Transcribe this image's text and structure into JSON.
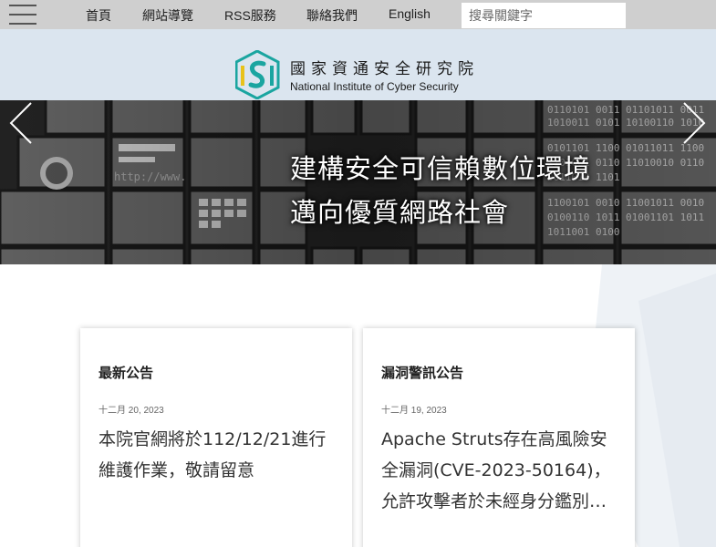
{
  "nav": {
    "items": [
      "首頁",
      "網站導覽",
      "RSS服務",
      "聯絡我們",
      "English"
    ],
    "search_placeholder": "搜尋關鍵字"
  },
  "header": {
    "org_name_zh": "國家資通安全研究院",
    "org_name_en": "National Institute of Cyber Security",
    "logo_icon": "nics-logo-icon"
  },
  "banner": {
    "slogan_line1": "建構安全可信賴數位環境",
    "slogan_line2": "邁向優質網路社會",
    "prev_icon": "chevron-left-icon",
    "next_icon": "chevron-right-icon"
  },
  "cards": [
    {
      "title": "最新公告",
      "date": "十二月 20, 2023",
      "body": "本院官網將於112/12/21進行維護作業，敬請留意"
    },
    {
      "title": "漏洞警訊公告",
      "date": "十二月 19, 2023",
      "body": "Apache Struts存在高風險安全漏洞(CVE-2023-50164)，允許攻擊者於未經身分鑑別…"
    }
  ],
  "colors": {
    "topbar": "#cfcfcf",
    "header_band": "#dbe5ef",
    "logo_teal": "#1aa5a0",
    "logo_yellow": "#e8c21a"
  }
}
